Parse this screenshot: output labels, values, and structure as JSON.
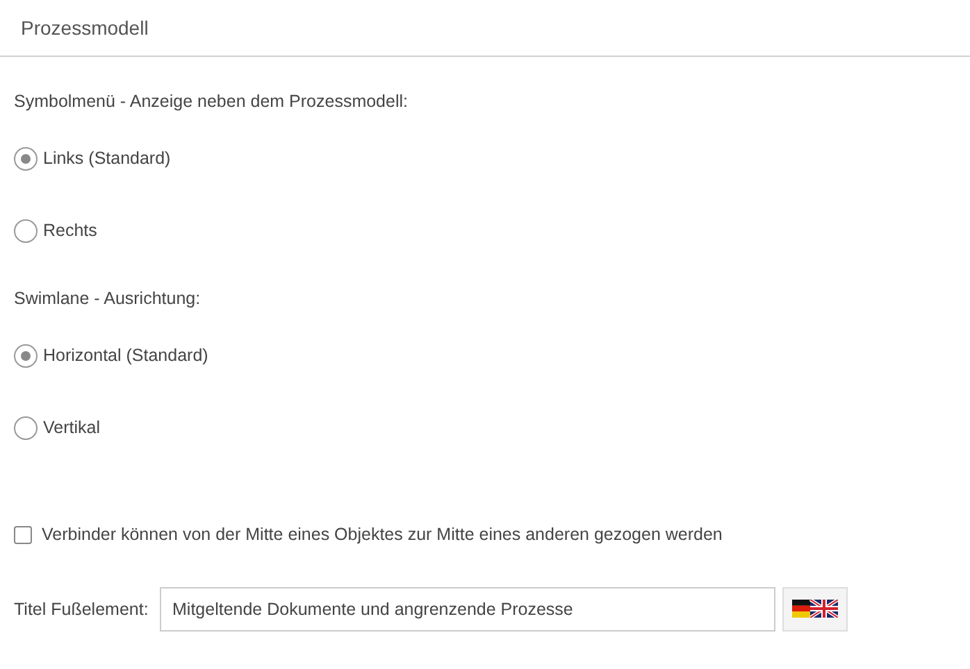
{
  "header": {
    "title": "Prozessmodell"
  },
  "radio_groups": [
    {
      "label": "Symbolmenü - Anzeige neben dem Prozessmodell:",
      "options": [
        {
          "label": "Links (Standard)",
          "selected": true
        },
        {
          "label": "Rechts",
          "selected": false
        }
      ]
    },
    {
      "label": "Swimlane - Ausrichtung:",
      "options": [
        {
          "label": "Horizontal (Standard)",
          "selected": true
        },
        {
          "label": "Vertikal",
          "selected": false
        }
      ]
    }
  ],
  "checkbox": {
    "label": "Verbinder können von der Mitte eines Objektes zur Mitte eines anderen gezogen werden",
    "checked": false
  },
  "footer_title": {
    "label": "Titel Fußelement:",
    "value": "Mitgeltende Dokumente und angrenzende Prozesse"
  }
}
